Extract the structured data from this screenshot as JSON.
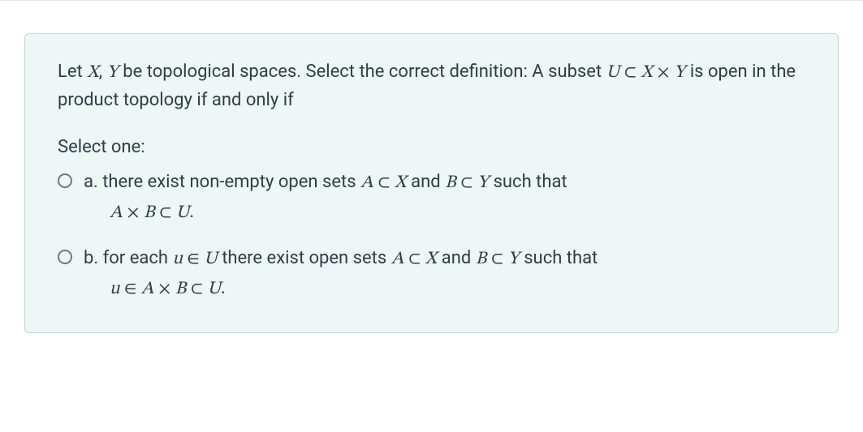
{
  "question": {
    "intro_parts": {
      "p1": "Let ",
      "X": "X",
      "comma": ", ",
      "Y": "Y",
      "p2": " be topological spaces. Select the correct definition: A subset ",
      "U": "U",
      "sub": " ⊂ ",
      "X2": "X",
      "times": " × ",
      "Y2": "Y",
      "p3": " is open in the product topology if and only if"
    },
    "prompt": "Select one:"
  },
  "options": {
    "a": {
      "label": "a.",
      "line1": {
        "p1": " there exist non-empty open sets ",
        "A": "A",
        "sub1": " ⊂ ",
        "X": "X",
        "and": " and ",
        "B": "B",
        "sub2": " ⊂ ",
        "Y": "Y",
        "p2": " such that"
      },
      "line2": {
        "A": "A",
        "times": " × ",
        "B": "B",
        "sub": " ⊂ ",
        "U": "U",
        "dot": "."
      }
    },
    "b": {
      "label": "b.",
      "line1": {
        "p1": " for each ",
        "u": "u",
        "in": " ∈ ",
        "U": "U",
        "p2": " there exist open sets ",
        "A": "A",
        "sub1": " ⊂ ",
        "X": "X",
        "and": " and ",
        "B": "B",
        "sub2": " ⊂ ",
        "Y": "Y",
        "p3": " such that"
      },
      "line2": {
        "u": "u",
        "in": " ∈ ",
        "A": "A",
        "times": " × ",
        "B": "B",
        "sub": " ⊂ ",
        "U": "U",
        "dot": "."
      }
    }
  }
}
